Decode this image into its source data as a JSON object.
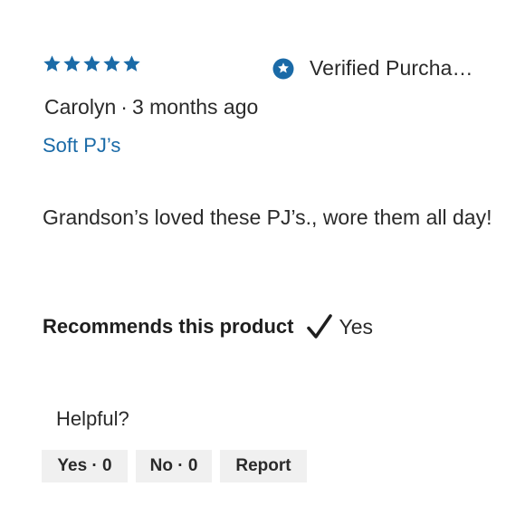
{
  "review": {
    "rating": 5,
    "rating_max": 5,
    "star_color": "#1a6aa7",
    "verified_label": "Verified Purcha…",
    "author": "Carolyn",
    "separator": "·",
    "time_ago": "3 months ago",
    "title": "Soft PJ’s",
    "body": "Grandson’s loved these PJ’s., wore them all day!"
  },
  "recommendation": {
    "label": "Recommends this product",
    "value": "Yes"
  },
  "feedback": {
    "helpful_label": "Helpful?",
    "yes_button": "Yes · 0",
    "no_button": "No · 0",
    "report_button": "Report"
  },
  "colors": {
    "accent": "#1a6aa7",
    "text": "#2a2a2a",
    "button_bg": "#f0f0f0"
  }
}
